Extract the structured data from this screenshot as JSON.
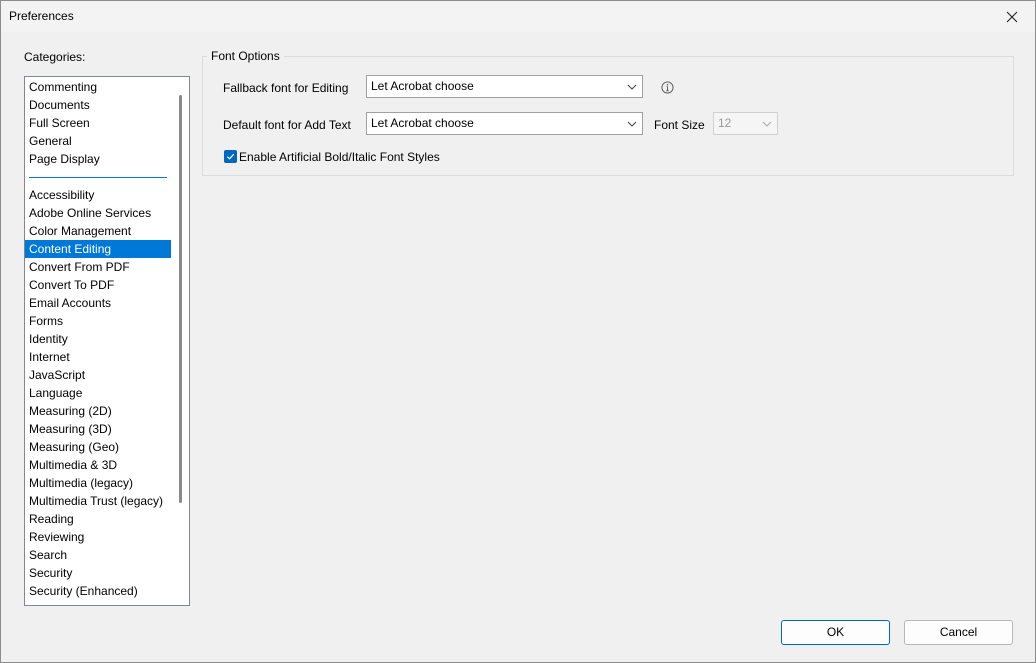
{
  "window": {
    "title": "Preferences"
  },
  "categories": {
    "label": "Categories:",
    "group1": [
      "Commenting",
      "Documents",
      "Full Screen",
      "General",
      "Page Display"
    ],
    "group2": [
      "Accessibility",
      "Adobe Online Services",
      "Color Management",
      "Content Editing",
      "Convert From PDF",
      "Convert To PDF",
      "Email Accounts",
      "Forms",
      "Identity",
      "Internet",
      "JavaScript",
      "Language",
      "Measuring (2D)",
      "Measuring (3D)",
      "Measuring (Geo)",
      "Multimedia & 3D",
      "Multimedia (legacy)",
      "Multimedia Trust (legacy)",
      "Reading",
      "Reviewing",
      "Search",
      "Security",
      "Security (Enhanced)"
    ],
    "selected": "Content Editing"
  },
  "font_options": {
    "legend": "Font Options",
    "fallback_label": "Fallback font for Editing",
    "fallback_value": "Let Acrobat choose",
    "default_label": "Default font for Add Text",
    "default_value": "Let Acrobat choose",
    "font_size_label": "Font Size",
    "font_size_value": "12",
    "checkbox_label": "Enable Artificial Bold/Italic Font Styles",
    "checkbox_checked": true
  },
  "buttons": {
    "ok": "OK",
    "cancel": "Cancel"
  },
  "colors": {
    "accent": "#0078d7",
    "checkbox": "#0067c0"
  }
}
